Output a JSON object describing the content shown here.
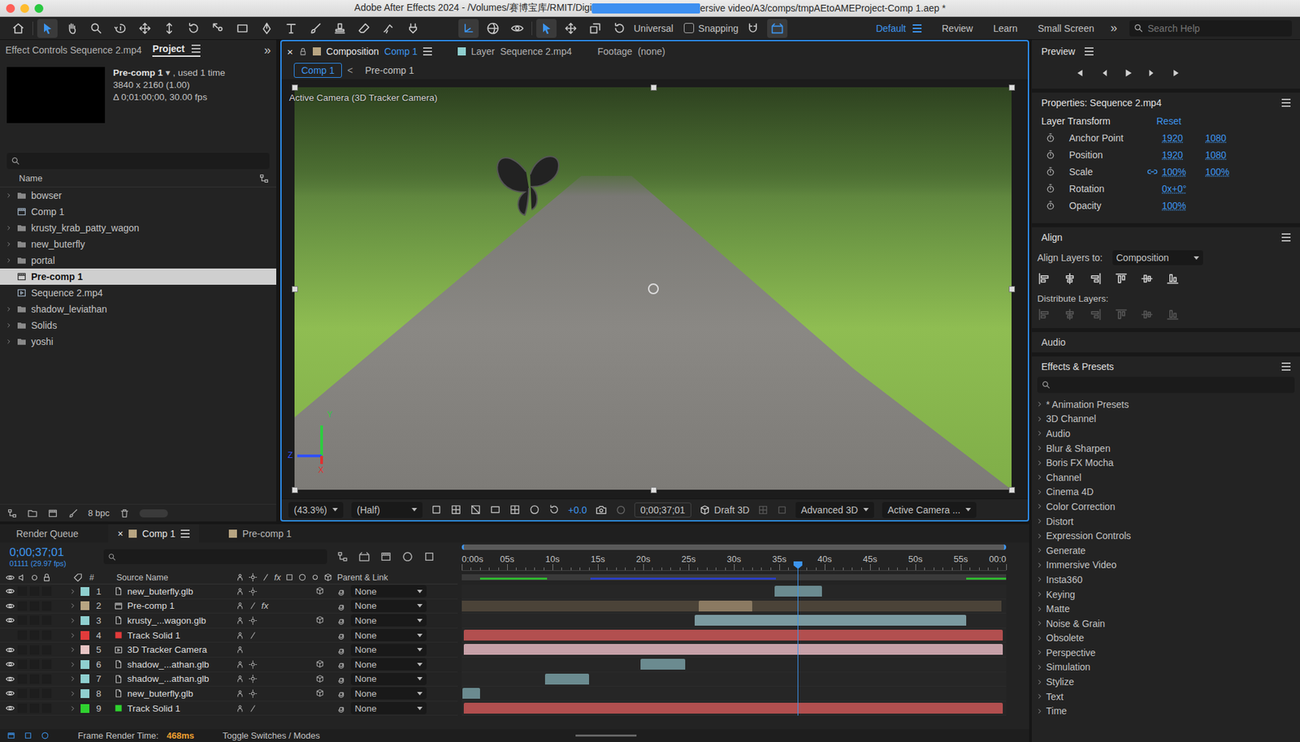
{
  "window": {
    "title_start": "Adobe After Effects 2024 - /Volumes/赛博宝库/RMIT/Digi",
    "title_end": "ersive video/A3/comps/tmpAEtoAMEProject-Comp 1.aep *"
  },
  "toolbar": {
    "tools": [
      {
        "kind": "home",
        "selected": false
      },
      {
        "kind": "select",
        "selected": true
      },
      {
        "kind": "hand",
        "selected": false
      },
      {
        "kind": "zoom",
        "selected": false
      },
      {
        "kind": "orbit",
        "selected": false
      },
      {
        "kind": "pan",
        "selected": false
      },
      {
        "kind": "dolly",
        "selected": false
      },
      {
        "kind": "rotate",
        "selected": false
      },
      {
        "kind": "anchor",
        "selected": false
      },
      {
        "kind": "rect",
        "selected": false
      },
      {
        "kind": "pen",
        "selected": false
      },
      {
        "kind": "type",
        "selected": false
      },
      {
        "kind": "brush",
        "selected": false
      },
      {
        "kind": "stamp",
        "selected": false
      },
      {
        "kind": "eraser",
        "selected": false
      },
      {
        "kind": "roto",
        "selected": false
      },
      {
        "kind": "puppet",
        "selected": false
      }
    ],
    "axis_tools": [
      {
        "kind": "local",
        "selected": true
      },
      {
        "kind": "world",
        "selected": false
      },
      {
        "kind": "view",
        "selected": false
      },
      {
        "kind": "select",
        "selected": true
      },
      {
        "kind": "pan",
        "selected": false
      },
      {
        "kind": "scale3d",
        "selected": false
      },
      {
        "kind": "rotate",
        "selected": false
      }
    ],
    "universal": "Universal",
    "snapping": {
      "label": "Snapping",
      "checked": false
    },
    "extra_tools": [
      {
        "kind": "snap",
        "selected": false
      },
      {
        "kind": "ground",
        "selected": true
      }
    ],
    "workspaces": [
      {
        "label": "Default",
        "selected": true
      },
      {
        "label": "Review",
        "selected": false
      },
      {
        "label": "Learn",
        "selected": false
      },
      {
        "label": "Small Screen",
        "selected": false
      }
    ],
    "more": "»",
    "search": {
      "placeholder": "Search Help"
    }
  },
  "project": {
    "tabs": [
      {
        "label": "Effect Controls Sequence 2.mp4",
        "selected": false
      },
      {
        "label": "Project",
        "selected": true
      }
    ],
    "more": "»",
    "info": {
      "name": "Pre-comp 1",
      "caret": "▾",
      "used": ", used 1 time",
      "size": "3840 x 2160 (1.00)",
      "duration": "Δ 0;01:00;00, 30.00 fps"
    },
    "column": "Name",
    "items": [
      {
        "name": "bowser",
        "kind": "folder",
        "selected": false
      },
      {
        "name": "Comp 1",
        "kind": "comp",
        "selected": false
      },
      {
        "name": "krusty_krab_patty_wagon",
        "kind": "folder",
        "selected": false
      },
      {
        "name": "new_buterfly",
        "kind": "folder",
        "selected": false
      },
      {
        "name": "portal",
        "kind": "folder",
        "selected": false
      },
      {
        "name": "Pre-comp 1",
        "kind": "comp",
        "selected": true
      },
      {
        "name": "Sequence 2.mp4",
        "kind": "footage",
        "selected": false
      },
      {
        "name": "shadow_leviathan",
        "kind": "folder",
        "selected": false
      },
      {
        "name": "Solids",
        "kind": "folder",
        "selected": false
      },
      {
        "name": "yoshi",
        "kind": "folder",
        "selected": false
      }
    ],
    "bpc": "8 bpc"
  },
  "viewer": {
    "close": "×",
    "tabs": [
      {
        "label": "Composition",
        "name": "Comp 1",
        "selected": true,
        "color": "#b8a582"
      },
      {
        "label": "Layer",
        "name": "Sequence 2.mp4",
        "selected": false,
        "color": "#8fcfcf"
      },
      {
        "label": "Footage",
        "name": "(none)",
        "selected": false,
        "color": ""
      }
    ],
    "breadcrumbs": [
      {
        "label": "Comp 1",
        "selected": true
      },
      {
        "label": "Pre-comp 1",
        "selected": false
      }
    ],
    "breadcrumb_sep": "<",
    "camera_label": "Active Camera (3D Tracker Camera)",
    "axes": {
      "x": "X",
      "y": "Y",
      "z": "Z"
    },
    "bottom": {
      "zoom": "(43.3%)",
      "resolution": "(Half)",
      "exposure": "+0.0",
      "timecode": "0;00;37;01",
      "draft": "Draft 3D",
      "renderer": "Advanced 3D",
      "view": "Active Camera ..."
    }
  },
  "preview": {
    "title": "Preview",
    "buttons": [
      {
        "kind": "first"
      },
      {
        "kind": "prev"
      },
      {
        "kind": "play"
      },
      {
        "kind": "next"
      },
      {
        "kind": "last"
      }
    ]
  },
  "properties": {
    "title": "Properties: Sequence 2.mp4",
    "section": "Layer Transform",
    "reset": "Reset",
    "rows": [
      {
        "label": "Anchor Point",
        "values": [
          "1920",
          "1080"
        ],
        "linked": false
      },
      {
        "label": "Position",
        "values": [
          "1920",
          "1080"
        ],
        "linked": false
      },
      {
        "label": "Scale",
        "values": [
          "100%",
          "100%"
        ],
        "linked": true
      },
      {
        "label": "Rotation",
        "values": [
          "0x+0°"
        ],
        "linked": false
      },
      {
        "label": "Opacity",
        "values": [
          "100%"
        ],
        "linked": false
      }
    ]
  },
  "align": {
    "title": "Align",
    "label": "Align Layers to:",
    "target": "Composition",
    "distribute": "Distribute Layers:"
  },
  "audio": {
    "title": "Audio"
  },
  "effects": {
    "title": "Effects & Presets",
    "items": [
      "* Animation Presets",
      "3D Channel",
      "Audio",
      "Blur & Sharpen",
      "Boris FX Mocha",
      "Channel",
      "Cinema 4D",
      "Color Correction",
      "Distort",
      "Expression Controls",
      "Generate",
      "Immersive Video",
      "Insta360",
      "Keying",
      "Matte",
      "Noise & Grain",
      "Obsolete",
      "Perspective",
      "Simulation",
      "Stylize",
      "Text",
      "Time"
    ]
  },
  "timeline": {
    "tabs": [
      {
        "label": "Render Queue",
        "selected": false,
        "closable": false,
        "color": ""
      },
      {
        "label": "Comp 1",
        "selected": true,
        "closable": true,
        "color": "#b8a582"
      },
      {
        "label": "Pre-comp 1",
        "selected": false,
        "closable": false,
        "color": "#b8a582"
      }
    ],
    "close": "×",
    "timecode": "0;00;37;01",
    "frames": "01111 (29.97 fps)",
    "columns": {
      "number": "#",
      "source": "Source Name",
      "fx": "fx",
      "parent": "Parent & Link"
    },
    "duration": 60,
    "playhead": {
      "level": 0.617
    },
    "ruler": [
      {
        "label": "0:00s",
        "at": 0
      },
      {
        "label": "05s",
        "at": 5
      },
      {
        "label": "10s",
        "at": 10
      },
      {
        "label": "15s",
        "at": 15
      },
      {
        "label": "20s",
        "at": 20
      },
      {
        "label": "25s",
        "at": 25
      },
      {
        "label": "30s",
        "at": 30
      },
      {
        "label": "35s",
        "at": 35
      },
      {
        "label": "40s",
        "at": 40
      },
      {
        "label": "45s",
        "at": 45
      },
      {
        "label": "50s",
        "at": 50
      },
      {
        "label": "55s",
        "at": 55
      },
      {
        "label": "00:0",
        "at": 60
      }
    ],
    "cache": [
      {
        "start": 2,
        "end": 9.4,
        "color": "#2fb82f"
      },
      {
        "start": 14.2,
        "end": 34.6,
        "color": "#2b3fc4"
      },
      {
        "start": 55.6,
        "end": 60,
        "color": "#2fb82f"
      }
    ],
    "layers": [
      {
        "index": "1",
        "name": "new_buterfly.glb",
        "kind": "glb",
        "label_color": "#8fcfcf",
        "visible": true,
        "three_d": true,
        "fx": "",
        "parent": "None",
        "start": 34.5,
        "end": 39.7,
        "bar_color": "#6b8b90"
      },
      {
        "index": "2",
        "name": "Pre-comp 1",
        "kind": "precomp",
        "label_color": "#b8a582",
        "visible": true,
        "three_d": false,
        "fx": "fx",
        "parent": "None",
        "start": 26.1,
        "end": 32,
        "bar_color": "#8b7a62",
        "source_extent": [
          0,
          59.5
        ],
        "source_color": "#4b4338"
      },
      {
        "index": "3",
        "name": "krusty_...wagon.glb",
        "kind": "glb",
        "label_color": "#8fcfcf",
        "visible": true,
        "three_d": true,
        "fx": "",
        "parent": "None",
        "start": 25.7,
        "end": 55.6,
        "bar_color": "#7b9aa0"
      },
      {
        "index": "4",
        "name": "Track Solid 1",
        "kind": "solid",
        "label_color": "#e23b3b",
        "visible": false,
        "three_d": false,
        "fx": "",
        "parent": "None",
        "start": 0.2,
        "end": 59.6,
        "bar_color": "#b24f4f"
      },
      {
        "index": "5",
        "name": "3D Tracker Camera",
        "kind": "camera",
        "label_color": "#e8c4c4",
        "visible": true,
        "three_d": false,
        "fx": "",
        "parent": "None",
        "start": 0.2,
        "end": 59.6,
        "bar_color": "#c7a0a8"
      },
      {
        "index": "6",
        "name": "shadow_...athan.glb",
        "kind": "glb",
        "label_color": "#8fcfcf",
        "visible": true,
        "three_d": true,
        "fx": "",
        "parent": "None",
        "start": 19.7,
        "end": 24.6,
        "bar_color": "#6b8b90"
      },
      {
        "index": "7",
        "name": "shadow_...athan.glb",
        "kind": "glb",
        "label_color": "#8fcfcf",
        "visible": true,
        "three_d": true,
        "fx": "",
        "parent": "None",
        "start": 9.2,
        "end": 14.0,
        "bar_color": "#6b8b90"
      },
      {
        "index": "8",
        "name": "new_buterfly.glb",
        "kind": "glb",
        "label_color": "#8fcfcf",
        "visible": true,
        "three_d": true,
        "fx": "",
        "parent": "None",
        "start": 0.1,
        "end": 2.0,
        "bar_color": "#6b8b90"
      },
      {
        "index": "9",
        "name": "Track Solid 1",
        "kind": "solid",
        "label_color": "#2fd22f",
        "visible": true,
        "three_d": false,
        "fx": "",
        "parent": "None",
        "start": 0.2,
        "end": 59.6,
        "bar_color": "#b24f4f"
      }
    ]
  },
  "status": {
    "label": "Frame Render Time:",
    "value": "468ms",
    "toggle": "Toggle Switches / Modes"
  }
}
